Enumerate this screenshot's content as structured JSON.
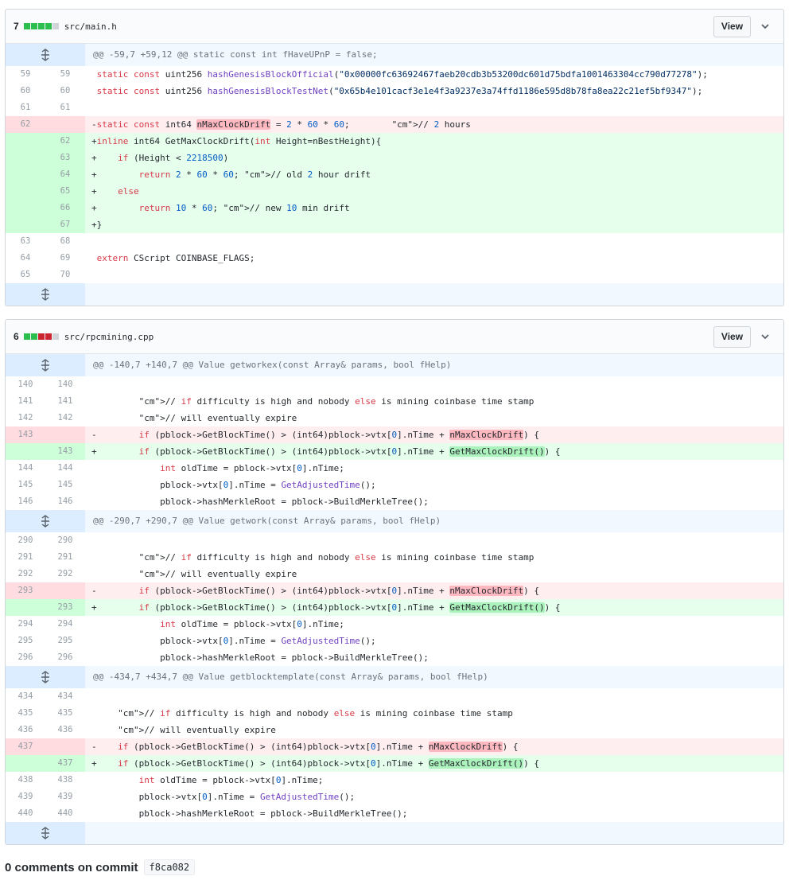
{
  "files": [
    {
      "count": "7",
      "path": "src/main.h",
      "view_label": "View",
      "hunk": "@@ -59,7 +59,12 @@ static const int fHaveUPnP = false;",
      "lines": [
        {
          "o": "59",
          "n": "59",
          "c": " static const uint256 hashGenesisBlockOfficial(\"0x00000fc63692467faeb20cdb3b53200dc601d75bdfa1001463304cc790d77278\");"
        },
        {
          "o": "60",
          "n": "60",
          "c": " static const uint256 hashGenesisBlockTestNet(\"0x65b4e101cacf3e1e4f3a9237e3a74ffd1186e595d8b78fa8ea22c21ef5bf9347\");"
        },
        {
          "o": "61",
          "n": "61",
          "c": ""
        },
        {
          "o": "62",
          "n": "",
          "c": "-static const int64 nMaxClockDrift = 2 * 60 * 60;        // 2 hours"
        },
        {
          "o": "",
          "n": "62",
          "c": "+inline int64 GetMaxClockDrift(int Height=nBestHeight){"
        },
        {
          "o": "",
          "n": "63",
          "c": "+    if (Height < 2218500)"
        },
        {
          "o": "",
          "n": "64",
          "c": "+        return 2 * 60 * 60; // old 2 hour drift"
        },
        {
          "o": "",
          "n": "65",
          "c": "+    else"
        },
        {
          "o": "",
          "n": "66",
          "c": "+        return 10 * 60; // new 10 min drift"
        },
        {
          "o": "",
          "n": "67",
          "c": "+}"
        },
        {
          "o": "63",
          "n": "68",
          "c": ""
        },
        {
          "o": "64",
          "n": "69",
          "c": " extern CScript COINBASE_FLAGS;"
        },
        {
          "o": "65",
          "n": "70",
          "c": ""
        }
      ]
    },
    {
      "count": "6",
      "path": "src/rpcmining.cpp",
      "view_label": "View",
      "hunks": [
        {
          "header": "@@ -140,7 +140,7 @@ Value getworkex(const Array& params, bool fHelp)",
          "lines": [
            {
              "o": "140",
              "n": "140",
              "c": ""
            },
            {
              "o": "141",
              "n": "141",
              "c": "         // if difficulty is high and nobody else is mining coinbase time stamp"
            },
            {
              "o": "142",
              "n": "142",
              "c": "         // will eventually expire"
            },
            {
              "o": "143",
              "n": "",
              "c": "-        if (pblock->GetBlockTime() > (int64)pblock->vtx[0].nTime + nMaxClockDrift) {"
            },
            {
              "o": "",
              "n": "143",
              "c": "+        if (pblock->GetBlockTime() > (int64)pblock->vtx[0].nTime + GetMaxClockDrift()) {"
            },
            {
              "o": "144",
              "n": "144",
              "c": "             int oldTime = pblock->vtx[0].nTime;"
            },
            {
              "o": "145",
              "n": "145",
              "c": "             pblock->vtx[0].nTime = GetAdjustedTime();"
            },
            {
              "o": "146",
              "n": "146",
              "c": "             pblock->hashMerkleRoot = pblock->BuildMerkleTree();"
            }
          ]
        },
        {
          "header": "@@ -290,7 +290,7 @@ Value getwork(const Array& params, bool fHelp)",
          "lines": [
            {
              "o": "290",
              "n": "290",
              "c": ""
            },
            {
              "o": "291",
              "n": "291",
              "c": "         // if difficulty is high and nobody else is mining coinbase time stamp"
            },
            {
              "o": "292",
              "n": "292",
              "c": "         // will eventually expire"
            },
            {
              "o": "293",
              "n": "",
              "c": "-        if (pblock->GetBlockTime() > (int64)pblock->vtx[0].nTime + nMaxClockDrift) {"
            },
            {
              "o": "",
              "n": "293",
              "c": "+        if (pblock->GetBlockTime() > (int64)pblock->vtx[0].nTime + GetMaxClockDrift()) {"
            },
            {
              "o": "294",
              "n": "294",
              "c": "             int oldTime = pblock->vtx[0].nTime;"
            },
            {
              "o": "295",
              "n": "295",
              "c": "             pblock->vtx[0].nTime = GetAdjustedTime();"
            },
            {
              "o": "296",
              "n": "296",
              "c": "             pblock->hashMerkleRoot = pblock->BuildMerkleTree();"
            }
          ]
        },
        {
          "header": "@@ -434,7 +434,7 @@ Value getblocktemplate(const Array& params, bool fHelp)",
          "lines": [
            {
              "o": "434",
              "n": "434",
              "c": ""
            },
            {
              "o": "435",
              "n": "435",
              "c": "     // if difficulty is high and nobody else is mining coinbase time stamp"
            },
            {
              "o": "436",
              "n": "436",
              "c": "     // will eventually expire"
            },
            {
              "o": "437",
              "n": "",
              "c": "-    if (pblock->GetBlockTime() > (int64)pblock->vtx[0].nTime + nMaxClockDrift) {"
            },
            {
              "o": "",
              "n": "437",
              "c": "+    if (pblock->GetBlockTime() > (int64)pblock->vtx[0].nTime + GetMaxClockDrift()) {"
            },
            {
              "o": "438",
              "n": "438",
              "c": "         int oldTime = pblock->vtx[0].nTime;"
            },
            {
              "o": "439",
              "n": "439",
              "c": "         pblock->vtx[0].nTime = GetAdjustedTime();"
            },
            {
              "o": "440",
              "n": "440",
              "c": "         pblock->hashMerkleRoot = pblock->BuildMerkleTree();"
            }
          ]
        }
      ]
    }
  ],
  "comments": {
    "label": "0 comments on commit",
    "sha": "f8ca082"
  },
  "colors": {
    "addition": "#2cbe4e",
    "deletion": "#cb2431",
    "neutral": "#d1d5da"
  }
}
